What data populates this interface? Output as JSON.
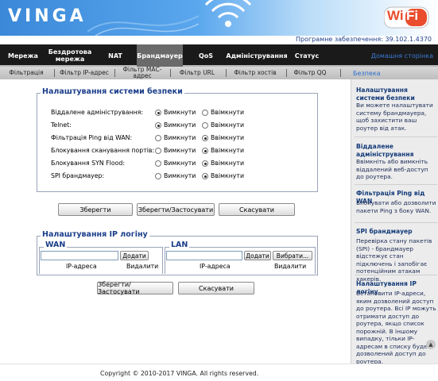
{
  "brand": {
    "name": "VINGA",
    "wifi_a": "Wi",
    "wifi_b": "Fi"
  },
  "version": "Програмне забезпечення: 39.102.1.4370",
  "nav": {
    "items": [
      {
        "label": "Мережа"
      },
      {
        "label": "Бездротова мережа"
      },
      {
        "label": "NAT"
      },
      {
        "label": "Брандмауер"
      },
      {
        "label": "QoS"
      },
      {
        "label": "Адміністрування"
      },
      {
        "label": "Статус"
      }
    ],
    "home_label": "Домашня сторінка"
  },
  "subnav": {
    "items": [
      {
        "label": "Фільтрація"
      },
      {
        "label": "Фільтр IP-адрес"
      },
      {
        "label": "Фільтр МАС-адрес"
      },
      {
        "label": "Фільтр URL"
      },
      {
        "label": "Фільтр хостів"
      },
      {
        "label": "Фільтр QQ"
      }
    ],
    "help_tab": "Безпека"
  },
  "security": {
    "title": "Налаштування системи безпеки",
    "on_label": "Вимкнути",
    "off_label": "Ввімкнути",
    "rows": [
      {
        "label": "Віддалене адміністрування:",
        "selected": "on"
      },
      {
        "label": "Telnet:",
        "selected": "on"
      },
      {
        "label": "Фільтрація Ping від WAN:",
        "selected": "off"
      },
      {
        "label": "Блокування сканування портів:",
        "selected": "off"
      },
      {
        "label": "Блокування SYN Flood:",
        "selected": "off"
      },
      {
        "label": "SPI брандмауер:",
        "selected": "off"
      }
    ],
    "buttons": {
      "save": "Зберегти",
      "save_apply": "Зберегти/Застосувати",
      "cancel": "Скасувати"
    }
  },
  "login": {
    "title": "Налаштування IP логіну",
    "wan": {
      "title": "WAN",
      "add": "Додати",
      "col_ip": "IP-адреса",
      "col_delete": "Видалити",
      "value": ""
    },
    "lan": {
      "title": "LAN",
      "add": "Додати",
      "choose": "Вибрати...",
      "col_ip": "IP-адреса",
      "col_delete": "Видалити",
      "value": ""
    },
    "buttons": {
      "save_apply": "Зберегти/Застосувати",
      "cancel": "Скасувати"
    }
  },
  "help": [
    {
      "title": "Налаштування системи безпеки",
      "text": "Ви можете налаштувати систему брандмауера, щоб захистити ваш роутер від атак."
    },
    {
      "title": "Віддалене адміністрування",
      "text": "Ввімкніть або вимкніть віддалений веб-доступ до роутера."
    },
    {
      "title": "Фільтрація Ping від WAN",
      "text": "Блокувати або дозволити пакети Ping з боку WAN."
    },
    {
      "title": "SPI брандмауер",
      "text": "Перевірка стану пакетів (SPI) - брандмауер відстежує стан підключень і запобігає потенційним атакам хакерів."
    },
    {
      "title": "Налаштування IP логіну",
      "text": "Встановити IP-адреси, яким дозволений доступ до роутера. Всі IP можуть отримати доступ до роутера, якщо список порожній. В іншому випадку, тільки IP-адресам в списку буде дозволений доступ до роутера."
    }
  ],
  "footer": {
    "copyright": "Copyright © 2010-2017 VINGA. All rights reserved."
  },
  "colors": {
    "accent": "#1b3e8a",
    "nav_bg": "#1a1a1a",
    "link": "#2c6fcd"
  }
}
